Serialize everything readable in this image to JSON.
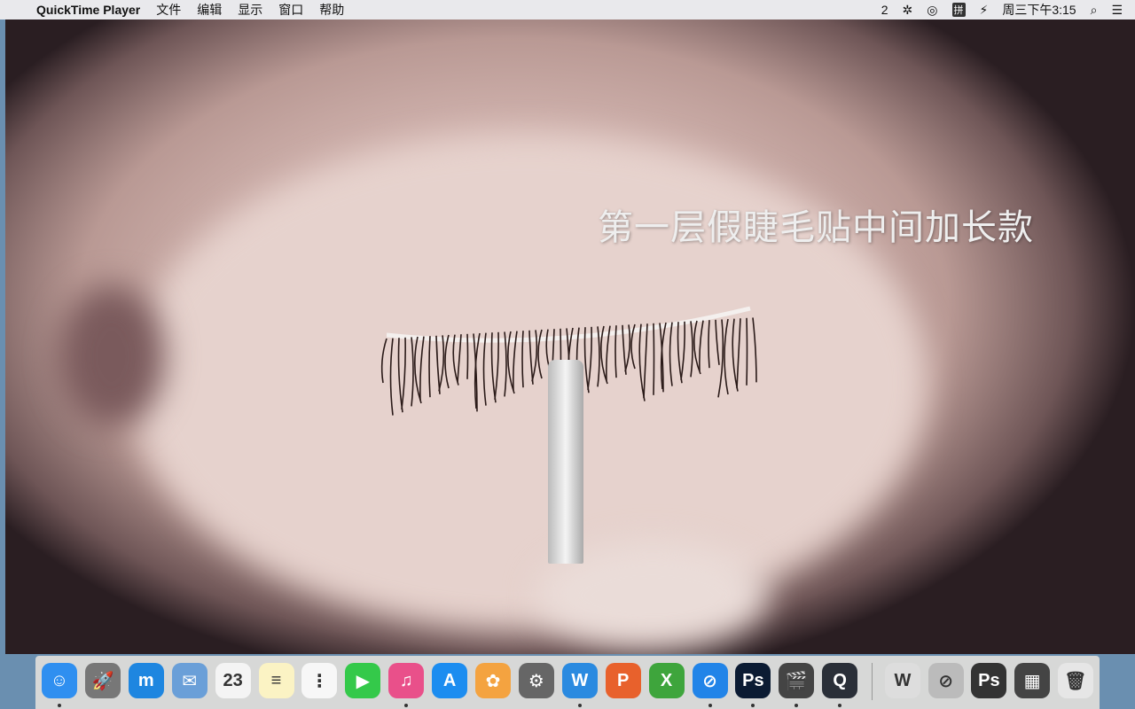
{
  "menubar": {
    "apple": "",
    "app": "QuickTime Player",
    "items": [
      "文件",
      "编辑",
      "显示",
      "窗口",
      "帮助"
    ],
    "status": {
      "adobe": "2",
      "bluetooth": "✲",
      "wifi": "◎",
      "ime": "拼",
      "battery": "⚡",
      "clock": "周三下午3:15",
      "search": "⌕",
      "list": "☰"
    }
  },
  "video": {
    "subtitle": "第一层假睫毛贴中间加长款"
  },
  "dock": {
    "apps": [
      {
        "name": "finder",
        "glyph": "☺",
        "color": "#2f8ff0",
        "running": true
      },
      {
        "name": "launchpad",
        "glyph": "🚀",
        "color": "#777",
        "running": false
      },
      {
        "name": "maxthon",
        "glyph": "m",
        "color": "#1e86e0",
        "running": false
      },
      {
        "name": "mail",
        "glyph": "✉",
        "color": "#6a9fd8",
        "running": false
      },
      {
        "name": "calendar",
        "glyph": "23",
        "color": "#f4f4f4",
        "running": false
      },
      {
        "name": "notes",
        "glyph": "≡",
        "color": "#fbf3c4",
        "running": false
      },
      {
        "name": "reminders",
        "glyph": "⋮",
        "color": "#f7f7f7",
        "running": false
      },
      {
        "name": "facetime",
        "glyph": "▶",
        "color": "#34c94a",
        "running": false
      },
      {
        "name": "itunes",
        "glyph": "♫",
        "color": "#e9508a",
        "running": true
      },
      {
        "name": "app-store",
        "glyph": "A",
        "color": "#1c8df0",
        "running": false
      },
      {
        "name": "photos",
        "glyph": "✿",
        "color": "#f4a340",
        "running": false
      },
      {
        "name": "system-preferences",
        "glyph": "⚙",
        "color": "#666",
        "running": false
      },
      {
        "name": "word",
        "glyph": "W",
        "color": "#2a8ae0",
        "running": true
      },
      {
        "name": "powerpoint",
        "glyph": "P",
        "color": "#e8612c",
        "running": false
      },
      {
        "name": "excel",
        "glyph": "X",
        "color": "#3ea53c",
        "running": false
      },
      {
        "name": "safari",
        "glyph": "⊘",
        "color": "#2184e8",
        "running": true
      },
      {
        "name": "photoshop",
        "glyph": "Ps",
        "color": "#0b1b33",
        "running": true
      },
      {
        "name": "final-cut-pro",
        "glyph": "🎬",
        "color": "#444",
        "running": true
      },
      {
        "name": "quicktime-player",
        "glyph": "Q",
        "color": "#2a2f38",
        "running": true
      }
    ],
    "windows": [
      {
        "name": "word-window",
        "glyph": "W",
        "color": "#ddd"
      },
      {
        "name": "safari-window",
        "glyph": "⊘",
        "color": "#bbb"
      },
      {
        "name": "photoshop-window",
        "glyph": "Ps",
        "color": "#333"
      },
      {
        "name": "final-cut-window",
        "glyph": "▦",
        "color": "#444"
      },
      {
        "name": "trash",
        "glyph": "🗑",
        "color": "#e6e6e6"
      }
    ]
  }
}
